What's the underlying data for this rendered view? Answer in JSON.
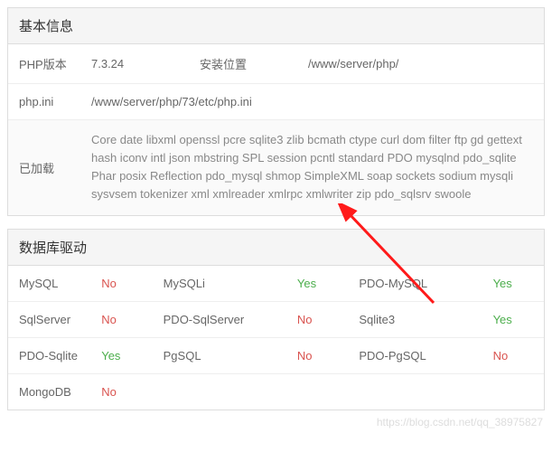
{
  "basic": {
    "title": "基本信息",
    "rows": [
      {
        "label": "PHP版本",
        "value": "7.3.24",
        "label2": "安装位置",
        "value2": "/www/server/php/"
      },
      {
        "label": "php.ini",
        "value": "/www/server/php/73/etc/php.ini"
      },
      {
        "label": "已加载",
        "value": "Core date libxml openssl pcre sqlite3 zlib bcmath ctype curl dom filter ftp gd gettext hash iconv intl json mbstring SPL session pcntl standard PDO mysqlnd pdo_sqlite Phar posix Reflection pdo_mysql shmop SimpleXML soap sockets sodium mysqli sysvsem tokenizer xml xmlreader xmlrpc xmlwriter zip pdo_sqlsrv swoole"
      }
    ]
  },
  "db": {
    "title": "数据库驱动",
    "yes": "Yes",
    "no": "No",
    "rows": [
      [
        {
          "label": "MySQL",
          "status": "No"
        },
        {
          "label": "MySQLi",
          "status": "Yes"
        },
        {
          "label": "PDO-MySQL",
          "status": "Yes"
        }
      ],
      [
        {
          "label": "SqlServer",
          "status": "No"
        },
        {
          "label": "PDO-SqlServer",
          "status": "No"
        },
        {
          "label": "Sqlite3",
          "status": "Yes"
        }
      ],
      [
        {
          "label": "PDO-Sqlite",
          "status": "Yes"
        },
        {
          "label": "PgSQL",
          "status": "No"
        },
        {
          "label": "PDO-PgSQL",
          "status": "No"
        }
      ],
      [
        {
          "label": "MongoDB",
          "status": "No"
        }
      ]
    ]
  },
  "watermark": "https://blog.csdn.net/qq_38975827"
}
